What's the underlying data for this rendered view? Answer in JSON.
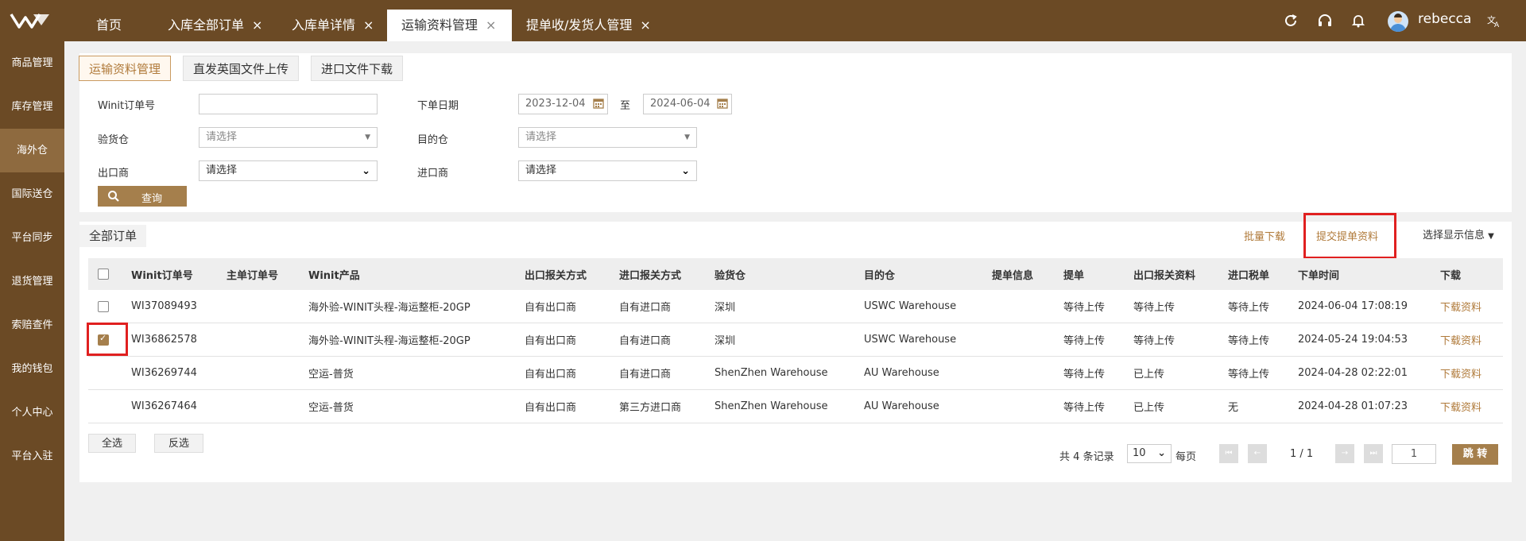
{
  "topbar": {
    "tabs": [
      {
        "label": "首页",
        "closable": false,
        "active": false
      },
      {
        "label": "入库全部订单",
        "closable": true,
        "active": false
      },
      {
        "label": "入库单详情",
        "closable": true,
        "active": false
      },
      {
        "label": "运输资料管理",
        "closable": true,
        "active": true
      },
      {
        "label": "提单收/发货人管理",
        "closable": true,
        "active": false
      }
    ],
    "close_glyph": "×",
    "username": "rebecca",
    "icons": [
      "refresh-icon",
      "headset-icon",
      "bell-icon",
      "translate-icon"
    ]
  },
  "sidebar": {
    "items": [
      "商品管理",
      "库存管理",
      "海外仓",
      "国际送仓",
      "平台同步",
      "退货管理",
      "索赔查件",
      "我的钱包",
      "个人中心",
      "平台入驻"
    ],
    "active_index": 2
  },
  "subtabs": [
    "运输资料管理",
    "直发英国文件上传",
    "进口文件下载"
  ],
  "filters": {
    "order_no_label": "Winit订单号",
    "order_no_value": "",
    "date_label": "下单日期",
    "date_from": "2023-12-04",
    "date_sep": "至",
    "date_to": "2024-06-04",
    "inspection_label": "验货仓",
    "inspection_placeholder": "请选择",
    "dest_label": "目的仓",
    "dest_placeholder": "请选择",
    "exporter_label": "出口商",
    "exporter_value": "请选择",
    "importer_label": "进口商",
    "importer_value": "请选择",
    "query_label": "查询"
  },
  "list": {
    "section_tab": "全部订单",
    "batch_download": "批量下载",
    "submit_bl": "提交提单资料",
    "choose_display": "选择显示信息",
    "columns": [
      "Winit订单号",
      "主单订单号",
      "Winit产品",
      "出口报关方式",
      "进口报关方式",
      "验货仓",
      "目的仓",
      "提单信息",
      "提单",
      "出口报关资料",
      "进口税单",
      "下单时间",
      "下载"
    ],
    "rows": [
      {
        "checkbox": "unchecked",
        "order": "WI37089493",
        "master": "",
        "product": "海外验-WINIT头程-海运整柜-20GP",
        "export": "自有出口商",
        "import": "自有进口商",
        "inspection": "深圳",
        "dest": "USWC Warehouse",
        "bl_info": "",
        "bl": "等待上传",
        "export_docs": "等待上传",
        "tax": "等待上传",
        "time": "2024-06-04 17:08:19",
        "download": "下载资料"
      },
      {
        "checkbox": "checked",
        "order": "WI36862578",
        "master": "",
        "product": "海外验-WINIT头程-海运整柜-20GP",
        "export": "自有出口商",
        "import": "自有进口商",
        "inspection": "深圳",
        "dest": "USWC Warehouse",
        "bl_info": "",
        "bl": "等待上传",
        "export_docs": "等待上传",
        "tax": "等待上传",
        "time": "2024-05-24 19:04:53",
        "download": "下载资料"
      },
      {
        "checkbox": "none",
        "order": "WI36269744",
        "master": "",
        "product": "空运-普货",
        "export": "自有出口商",
        "import": "自有进口商",
        "inspection": "ShenZhen Warehouse",
        "dest": "AU Warehouse",
        "bl_info": "",
        "bl": "等待上传",
        "export_docs": "已上传",
        "tax": "等待上传",
        "time": "2024-04-28 02:22:01",
        "download": "下载资料"
      },
      {
        "checkbox": "none",
        "order": "WI36267464",
        "master": "",
        "product": "空运-普货",
        "export": "自有出口商",
        "import": "第三方进口商",
        "inspection": "ShenZhen Warehouse",
        "dest": "AU Warehouse",
        "bl_info": "",
        "bl": "等待上传",
        "export_docs": "已上传",
        "tax": "无",
        "time": "2024-04-28 01:07:23",
        "download": "下载资料"
      }
    ],
    "select_all": "全选",
    "invert": "反选"
  },
  "pagination": {
    "total_prefix": "共",
    "total": "4",
    "total_suffix": "条记录",
    "page_size": "10",
    "per_page": "每页",
    "page_info": "1 / 1",
    "page_input": "1",
    "jump": "跳 转"
  },
  "colors": {
    "brand": "#6b4a25",
    "accent": "#a57f4c",
    "highlight": "#e02020"
  }
}
